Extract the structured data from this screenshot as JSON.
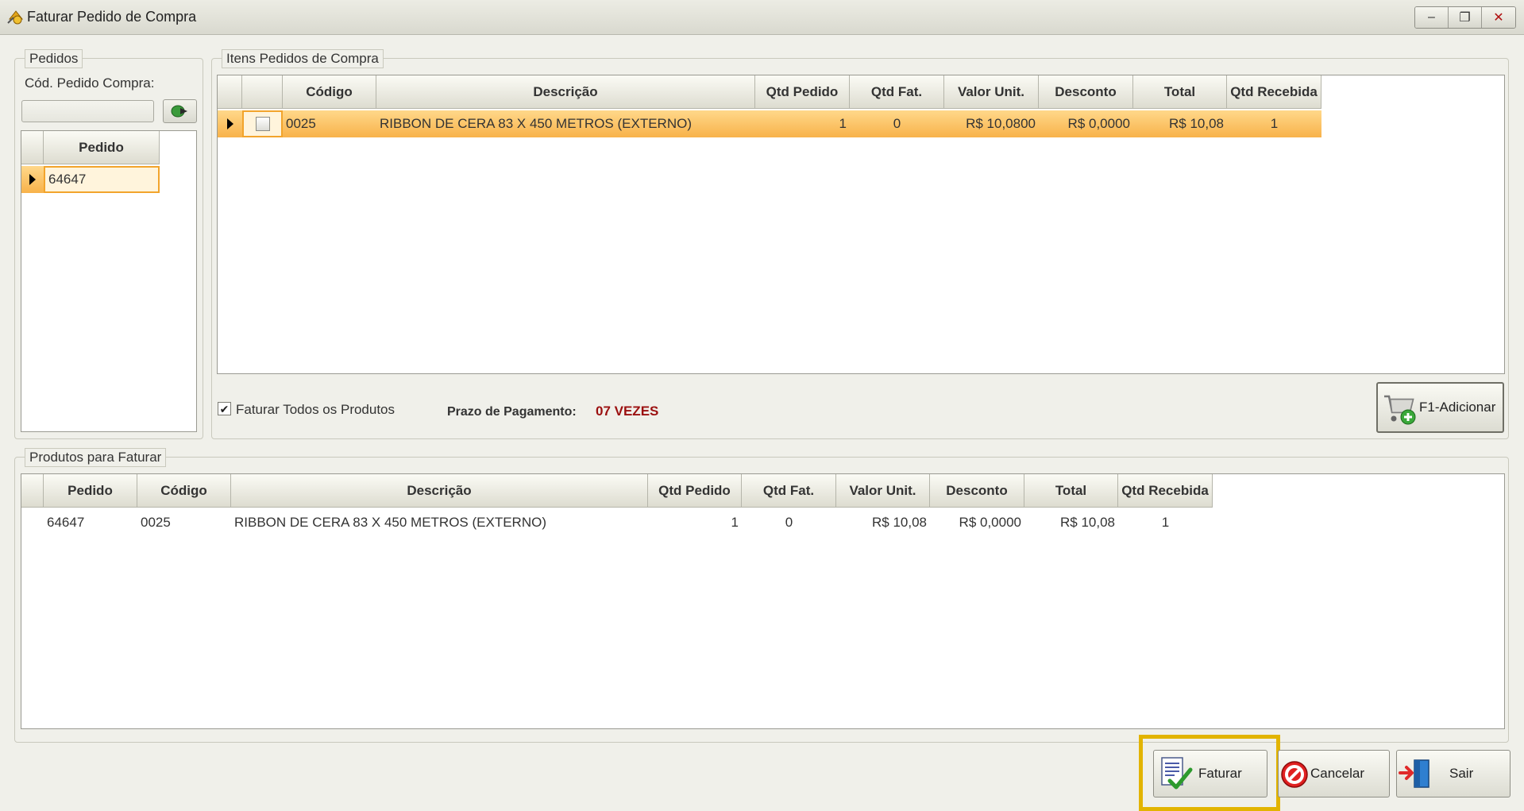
{
  "window": {
    "title": "Faturar Pedido de Compra",
    "minimize": "–",
    "restore": "❐",
    "close": "✕"
  },
  "pedidos": {
    "legend": "Pedidos",
    "cod_label": "Cód. Pedido Compra:",
    "cod_value": "",
    "grid": {
      "header": "Pedido",
      "rows": [
        "64647"
      ]
    }
  },
  "itens": {
    "legend": "Itens Pedidos de Compra",
    "columns": [
      "Código",
      "Descrição",
      "Qtd Pedido",
      "Qtd Fat.",
      "Valor Unit.",
      "Desconto",
      "Total",
      "Qtd Recebida"
    ],
    "rows": [
      {
        "codigo": "0025",
        "descricao": "RIBBON DE CERA 83 X 450 METROS (EXTERNO)",
        "qtd_pedido": "1",
        "qtd_fat": "0",
        "valor_unit": "R$ 10,0800",
        "desconto": "R$ 0,0000",
        "total": "R$ 10,08",
        "qtd_recebida": "1"
      }
    ],
    "faturar_todos_label": "Faturar Todos os Produtos",
    "faturar_todos_checked": true,
    "prazo_label": "Prazo de Pagamento:",
    "prazo_value": "07 VEZES",
    "prazo_color": "#9b1010",
    "add_button": "F1-Adicionar"
  },
  "produtos": {
    "legend": "Produtos para Faturar",
    "columns": [
      "Pedido",
      "Código",
      "Descrição",
      "Qtd Pedido",
      "Qtd Fat.",
      "Valor Unit.",
      "Desconto",
      "Total",
      "Qtd Recebida"
    ],
    "rows": [
      {
        "pedido": "64647",
        "codigo": "0025",
        "descricao": "RIBBON DE CERA 83 X 450 METROS (EXTERNO)",
        "qtd_pedido": "1",
        "qtd_fat": "0",
        "valor_unit": "R$ 10,08",
        "desconto": "R$ 0,0000",
        "total": "R$ 10,08",
        "qtd_recebida": "1"
      }
    ]
  },
  "footer": {
    "faturar": "Faturar",
    "cancelar": "Cancelar",
    "sair": "Sair",
    "highlight_color": "#e2b400"
  }
}
